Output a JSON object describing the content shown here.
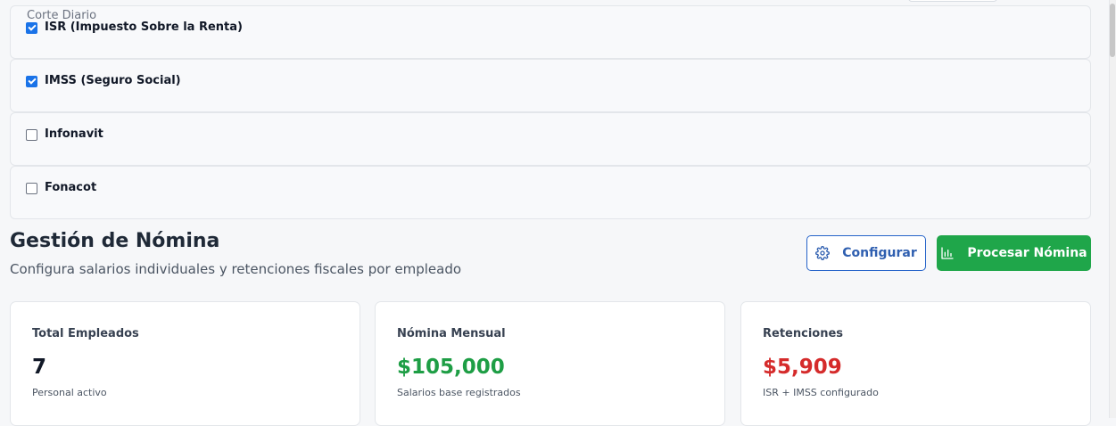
{
  "corte_label": "Corte Diario",
  "deductions": [
    {
      "label": "ISR (Impuesto Sobre la Renta)",
      "checked": true
    },
    {
      "label": "IMSS (Seguro Social)",
      "checked": true
    },
    {
      "label": "Infonavit",
      "checked": false
    },
    {
      "label": "Fonacot",
      "checked": false
    }
  ],
  "header": {
    "title": "Gestión de Nómina",
    "subtitle": "Configura salarios individuales y retenciones fiscales por empleado",
    "configure_label": "Configurar",
    "process_label": "Procesar Nómina"
  },
  "stats": [
    {
      "label": "Total Empleados",
      "value": "7",
      "sub": "Personal activo",
      "color": "#111827"
    },
    {
      "label": "Nómina Mensual",
      "value": "$105,000",
      "sub": "Salarios base registrados",
      "color": "#1e9e45"
    },
    {
      "label": "Retenciones",
      "value": "$5,909",
      "sub": "ISR + IMSS configurado",
      "color": "#d52b2b"
    }
  ],
  "colors": {
    "accent_blue": "#2563c9",
    "accent_green": "#1fa64a",
    "checkbox_blue": "#1a73e8"
  }
}
